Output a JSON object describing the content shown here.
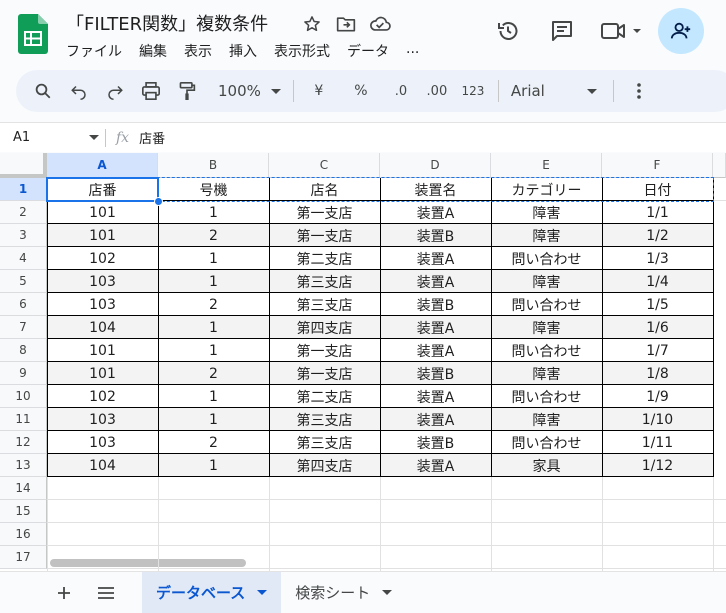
{
  "header": {
    "title": "「FILTER関数」複数条件",
    "menu": [
      "ファイル",
      "編集",
      "表示",
      "挿入",
      "表示形式",
      "データ",
      "..."
    ]
  },
  "toolbar": {
    "zoom": "100%",
    "currency": "¥",
    "percent": "%",
    "decimal_decrease": ".0",
    "decimal_increase": ".00",
    "number_format": "123",
    "font": "Arial"
  },
  "formula_bar": {
    "cell_ref": "A1",
    "fx": "fx",
    "content": "店番"
  },
  "grid": {
    "columns": [
      "A",
      "B",
      "C",
      "D",
      "E",
      "F"
    ],
    "rows": [
      "1",
      "2",
      "3",
      "4",
      "5",
      "6",
      "7",
      "8",
      "9",
      "10",
      "11",
      "12",
      "13",
      "14",
      "15",
      "16",
      "17"
    ],
    "table_header": [
      "店番",
      "号機",
      "店名",
      "装置名",
      "カテゴリー",
      "日付"
    ],
    "table_rows": [
      [
        "101",
        "1",
        "第一支店",
        "装置A",
        "障害",
        "1/1"
      ],
      [
        "101",
        "2",
        "第一支店",
        "装置B",
        "障害",
        "1/2"
      ],
      [
        "102",
        "1",
        "第二支店",
        "装置A",
        "問い合わせ",
        "1/3"
      ],
      [
        "103",
        "1",
        "第三支店",
        "装置A",
        "障害",
        "1/4"
      ],
      [
        "103",
        "2",
        "第三支店",
        "装置B",
        "問い合わせ",
        "1/5"
      ],
      [
        "104",
        "1",
        "第四支店",
        "装置A",
        "障害",
        "1/6"
      ],
      [
        "101",
        "1",
        "第一支店",
        "装置A",
        "問い合わせ",
        "1/7"
      ],
      [
        "101",
        "2",
        "第一支店",
        "装置B",
        "障害",
        "1/8"
      ],
      [
        "102",
        "1",
        "第二支店",
        "装置A",
        "問い合わせ",
        "1/9"
      ],
      [
        "103",
        "1",
        "第三支店",
        "装置A",
        "障害",
        "1/10"
      ],
      [
        "103",
        "2",
        "第三支店",
        "装置B",
        "問い合わせ",
        "1/11"
      ],
      [
        "104",
        "1",
        "第四支店",
        "装置A",
        "家具",
        "1/12"
      ]
    ]
  },
  "sheets": [
    {
      "label": "データベース",
      "active": true
    },
    {
      "label": "検索シート",
      "active": false
    }
  ],
  "colors": {
    "accent": "#0b57d0",
    "selection": "#1a73e8",
    "share_bg": "#c2e7ff",
    "logo_green": "#0f9d58"
  }
}
